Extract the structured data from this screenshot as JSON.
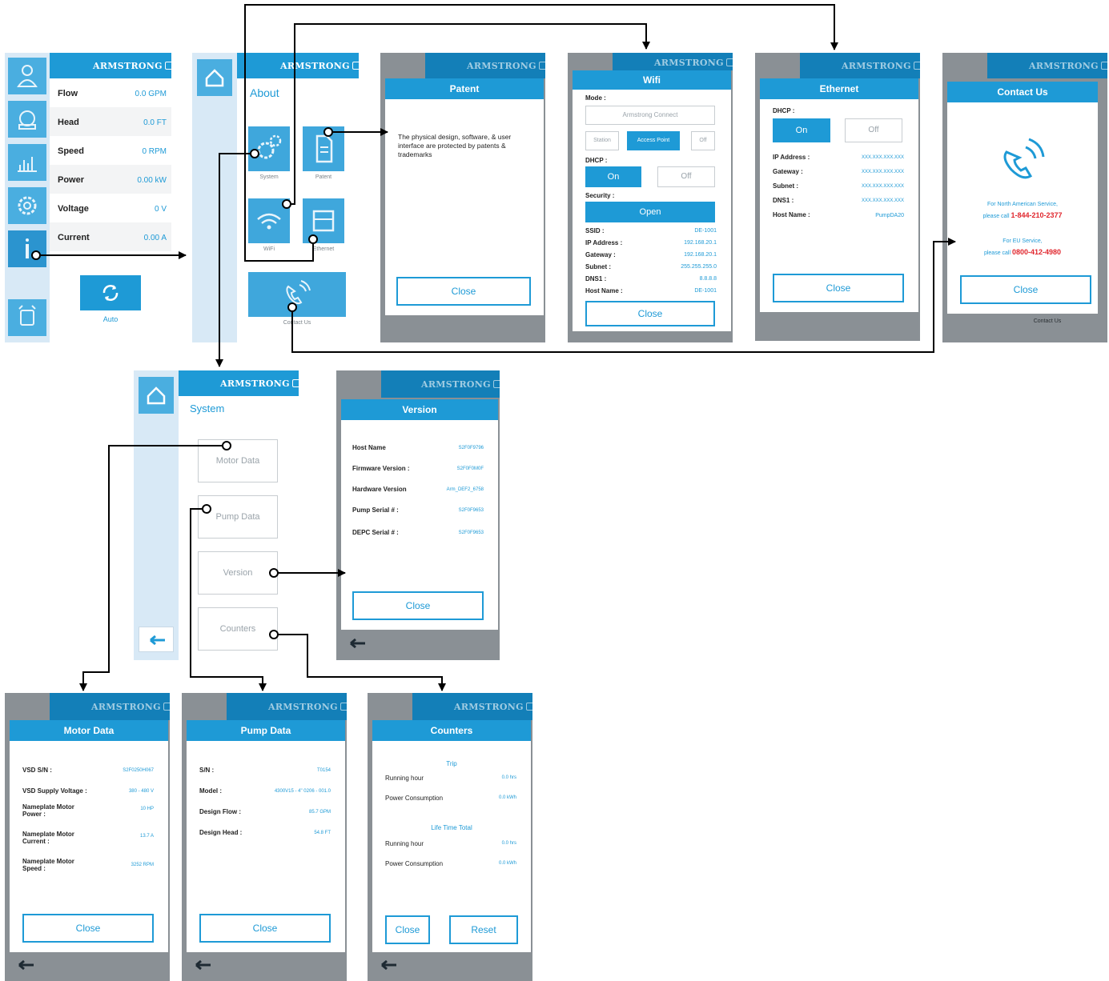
{
  "brand": "ARMSTRONG",
  "dashboard": {
    "rows": [
      {
        "label": "Flow",
        "value": "0.0 GPM"
      },
      {
        "label": "Head",
        "value": "0.0 FT"
      },
      {
        "label": "Speed",
        "value": "0 RPM"
      },
      {
        "label": "Power",
        "value": "0.00 kW"
      },
      {
        "label": "Voltage",
        "value": "0 V"
      },
      {
        "label": "Current",
        "value": "0.00 A"
      }
    ],
    "mode_label": "Auto",
    "side_icons": [
      "user-icon",
      "pump-icon",
      "chart-icon",
      "gear-icon",
      "info-icon",
      "alarm-icon"
    ]
  },
  "about": {
    "title": "About",
    "tiles": [
      {
        "label": "System",
        "icon": "gears-icon"
      },
      {
        "label": "Patent",
        "icon": "document-icon"
      },
      {
        "label": "WiFi",
        "icon": "wifi-icon"
      },
      {
        "label": "Ethernet",
        "icon": "ethernet-icon"
      },
      {
        "label": "Contact Us",
        "icon": "phone-icon"
      }
    ]
  },
  "patent": {
    "title": "Patent",
    "text": "The physical design, software, & user interface are protected by patents & trademarks",
    "close": "Close"
  },
  "wifi": {
    "title": "Wifi",
    "mode_label": "Mode :",
    "mode_value": "Armstrong Connect",
    "mode_options": [
      "Station",
      "Access Point",
      "Off"
    ],
    "dhcp_label": "DHCP :",
    "dhcp_on": "On",
    "dhcp_off": "Off",
    "security_label": "Security :",
    "security_value": "Open",
    "rows": [
      {
        "label": "SSID :",
        "value": "DE-1001"
      },
      {
        "label": "IP Address :",
        "value": "192.168.20.1"
      },
      {
        "label": "Gateway :",
        "value": "192.168.20.1"
      },
      {
        "label": "Subnet :",
        "value": "255.255.255.0"
      },
      {
        "label": "DNS1 :",
        "value": "8.8.8.8"
      },
      {
        "label": "Host Name :",
        "value": "DE-1001"
      }
    ],
    "close": "Close"
  },
  "ethernet": {
    "title": "Ethernet",
    "dhcp_label": "DHCP :",
    "dhcp_on": "On",
    "dhcp_off": "Off",
    "rows": [
      {
        "label": "IP Address :",
        "value": "XXX.XXX.XXX.XXX"
      },
      {
        "label": "Gateway :",
        "value": "XXX.XXX.XXX.XXX"
      },
      {
        "label": "Subnet :",
        "value": "XXX.XXX.XXX.XXX"
      },
      {
        "label": "DNS1 :",
        "value": "XXX.XXX.XXX.XXX"
      },
      {
        "label": "Host Name :",
        "value": "PumpDA20"
      }
    ],
    "close": "Close"
  },
  "contact": {
    "title": "Contact Us",
    "na_line1": "For North American Service,",
    "na_line2": "please call",
    "na_phone": "1-844-210-2377",
    "eu_line1": "For EU Service,",
    "eu_line2": "please call",
    "eu_phone": "0800-412-4980",
    "close": "Close",
    "behind_label": "Contact Us"
  },
  "system": {
    "title": "System",
    "buttons": [
      "Motor Data",
      "Pump Data",
      "Version",
      "Counters"
    ]
  },
  "version": {
    "title": "Version",
    "rows": [
      {
        "label": "Host Name",
        "value": "S2F0F9796"
      },
      {
        "label": "Firmware Version :",
        "value": "S2F0F0M0F"
      },
      {
        "label": "Hardware Version",
        "value": "Arm_DEF2_6758"
      },
      {
        "label": "Pump Serial # :",
        "value": "S2F0F9653"
      },
      {
        "label": "DEPC Serial # :",
        "value": "S2F0F9653"
      }
    ],
    "close": "Close"
  },
  "motor": {
    "title": "Motor Data",
    "rows": [
      {
        "label": "VSD S/N :",
        "value": "S2F0250H067"
      },
      {
        "label": "VSD Supply Voltage :",
        "value": "380 - 480 V"
      },
      {
        "label": "Nameplate Motor Power :",
        "value": "10 HP"
      },
      {
        "label": "Nameplate Motor Current :",
        "value": "13.7 A"
      },
      {
        "label": "Nameplate Motor Speed :",
        "value": "3252 RPM"
      }
    ],
    "close": "Close"
  },
  "pump": {
    "title": "Pump Data",
    "rows": [
      {
        "label": "S/N :",
        "value": "T0154"
      },
      {
        "label": "Model :",
        "value": "4300V15 - 4\" 0206 - 001.0"
      },
      {
        "label": "Design Flow :",
        "value": "85.7 GPM"
      },
      {
        "label": "Design Head :",
        "value": "54.8 FT"
      }
    ],
    "close": "Close"
  },
  "counters": {
    "title": "Counters",
    "trip_label": "Trip",
    "trip_rows": [
      {
        "label": "Running hour",
        "value": "0.0 hrs"
      },
      {
        "label": "Power Consumption",
        "value": "0.0 kWh"
      }
    ],
    "life_label": "Life Time Total",
    "life_rows": [
      {
        "label": "Running hour",
        "value": "0.0 hrs"
      },
      {
        "label": "Power Consumption",
        "value": "0.0 kWh"
      }
    ],
    "close": "Close",
    "reset": "Reset"
  },
  "colors": {
    "accent": "#1e9ad6",
    "accent_dark": "#137fb8",
    "panel_gray": "#8a9095",
    "phone_red": "#e0262d"
  }
}
